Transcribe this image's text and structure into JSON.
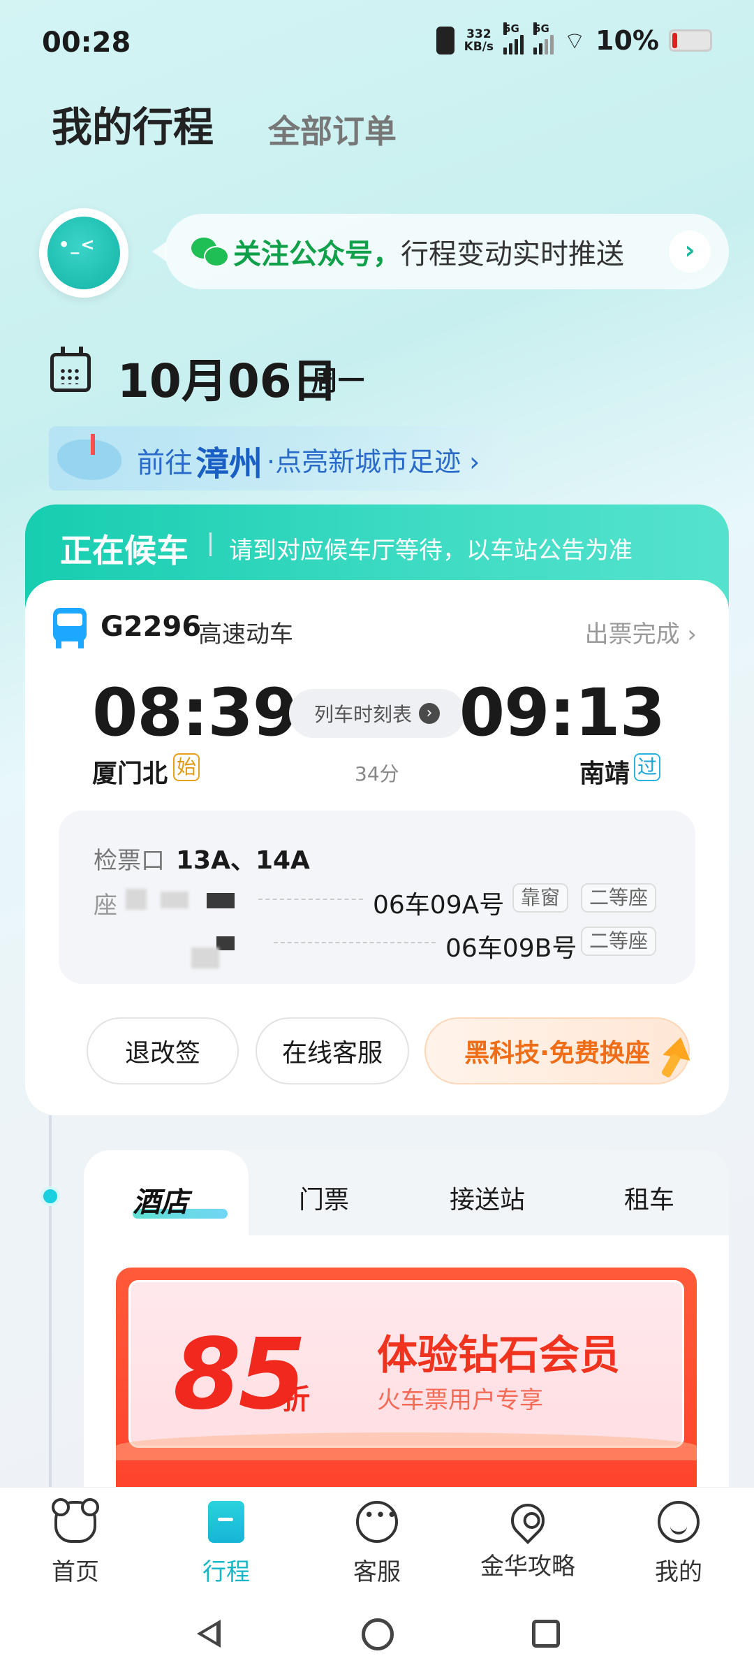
{
  "status_bar": {
    "time": "00:28",
    "net_speed": "332",
    "net_unit": "KB/s",
    "sig1": "5G",
    "sig2": "5G",
    "battery": "10%"
  },
  "header": {
    "title": "我的行程",
    "tab2": "全部订单"
  },
  "banner": {
    "highlight": "关注公众号，",
    "text": "行程变动实时推送",
    "arrow": "›"
  },
  "date": {
    "main": "10月06日",
    "weekday": "周一"
  },
  "destination": {
    "prefix": "前往",
    "city": "漳州",
    "suffix": "·点亮新城市足迹 ›"
  },
  "waiting": {
    "title": "正在候车",
    "note": "请到对应候车厅等待，以车站公告为准"
  },
  "train": {
    "number": "G2296",
    "type": "高速动车",
    "status": "出票完成 ›",
    "dep_time": "08:39",
    "arr_time": "09:13",
    "timetable_label": "列车时刻表",
    "duration": "34分",
    "dep_station": "厦门北",
    "dep_badge": "始",
    "arr_station": "南靖",
    "arr_badge": "过"
  },
  "seats": {
    "gate_label": "检票口",
    "gate_value": "13A、14A",
    "seat_label": "座",
    "seat1": "06车09A号",
    "seat1_tag": "靠窗",
    "seat1_class": "二等座",
    "seat2": "06车09B号",
    "seat2_class": "二等座"
  },
  "actions": {
    "refund": "退改签",
    "service": "在线客服",
    "seat_swap": "黑科技·免费换座"
  },
  "services": {
    "tabs": [
      "酒店",
      "门票",
      "接送站",
      "租车"
    ]
  },
  "promo": {
    "discount": "85",
    "unit": "折",
    "title": "体验钻石会员",
    "subtitle": "火车票用户专享"
  },
  "bottom_nav": {
    "items": [
      {
        "label": "首页",
        "icon": "home-icon"
      },
      {
        "label": "行程",
        "icon": "trip-icon"
      },
      {
        "label": "客服",
        "icon": "chat-icon"
      },
      {
        "label": "金华攻略",
        "icon": "location-icon"
      },
      {
        "label": "我的",
        "icon": "smile-icon"
      }
    ],
    "active_color": "#13b7c8"
  },
  "colors": {
    "accent": "#17cdb0",
    "promo": "#f0281e",
    "seat_swap": "#ef6d16"
  }
}
